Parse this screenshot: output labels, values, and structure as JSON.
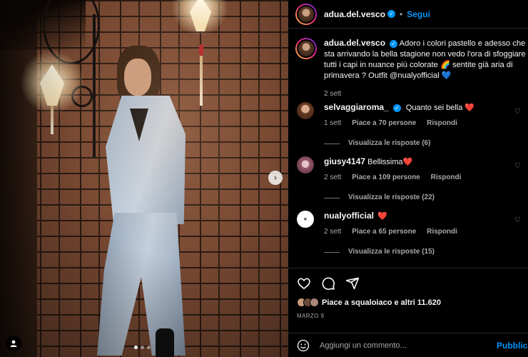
{
  "header": {
    "username": "adua.del.vesco",
    "separator": "•",
    "follow_label": "Segui",
    "more_label": "⋯"
  },
  "caption": {
    "username": "adua.del.vesco",
    "text": "Adoro i colori pastello e adesso che sta arrivando la bella stagione non vedo l'ora di sfoggiare tutti i capi in nuance più colorate 🌈 sentite già aria di primavera ? Outfit @nualyofficial 💙",
    "time": "2 sett"
  },
  "comments": [
    {
      "username": "selvaggiaroma_",
      "verified": true,
      "text": "Quanto sei bella ❤️",
      "time": "1 sett",
      "likes": "Piace a 70 persone",
      "reply_label": "Rispondi",
      "view_replies": "Visualizza le risposte (6)",
      "avatar_color": "#7a4b3a"
    },
    {
      "username": "giusy4147",
      "verified": false,
      "text": "Bellissima❤️",
      "time": "2 sett",
      "likes": "Piace a 109 persone",
      "reply_label": "Rispondi",
      "view_replies": "Visualizza le risposte (22)",
      "avatar_color": "#b07a8c"
    },
    {
      "username": "nualyofficial",
      "verified": false,
      "text": "❤️",
      "time": "2 sett",
      "likes": "Piace a 65 persone",
      "reply_label": "Rispondi",
      "view_replies": "Visualizza le risposte (15)",
      "avatar_color": "#ffffff"
    }
  ],
  "post": {
    "likes_text": "Piace a squaloiaco e altri 11.620",
    "date": "MARZO 9",
    "comment_placeholder": "Aggiungi un commento...",
    "publish_label": "Pubblica"
  },
  "colors": {
    "accent": "#0095f6",
    "background": "#000000",
    "muted": "#a8a8a8",
    "divider": "#262626"
  },
  "carousel": {
    "next_icon": "chevron-right-icon",
    "slides": 3,
    "active_slide": 1
  }
}
